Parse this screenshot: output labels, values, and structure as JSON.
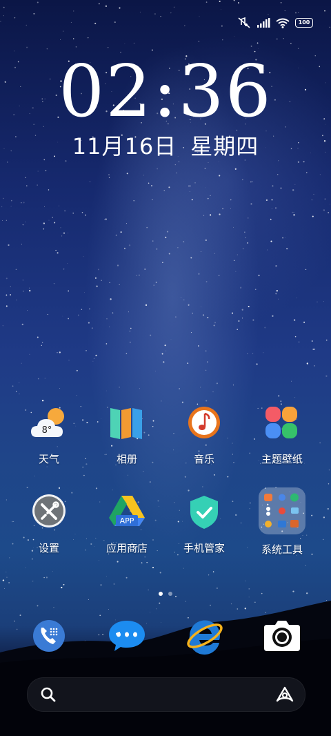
{
  "status_bar": {
    "battery": "100",
    "icons": [
      "mute-icon",
      "signal-icon",
      "wifi-icon",
      "battery-icon"
    ]
  },
  "clock": {
    "time": "02:36"
  },
  "date": {
    "day": "11月16日",
    "weekday": "星期四"
  },
  "apps": [
    {
      "label": "天气",
      "icon": "weather-icon",
      "temp": "8°"
    },
    {
      "label": "相册",
      "icon": "gallery-icon"
    },
    {
      "label": "音乐",
      "icon": "music-icon"
    },
    {
      "label": "主题壁纸",
      "icon": "themes-icon"
    },
    {
      "label": "设置",
      "icon": "settings-icon"
    },
    {
      "label": "应用商店",
      "icon": "app-store-icon",
      "badge": "APP"
    },
    {
      "label": "手机管家",
      "icon": "security-icon"
    },
    {
      "label": "系统工具",
      "icon": "folder-icon"
    }
  ],
  "page_indicator": {
    "pages": 2,
    "current": 1
  },
  "dock": [
    {
      "icon": "phone-icon"
    },
    {
      "icon": "messages-icon"
    },
    {
      "icon": "browser-icon"
    },
    {
      "icon": "camera-icon"
    }
  ],
  "search": {
    "icons": [
      "search-icon",
      "assistant-icon"
    ]
  },
  "colors": {
    "weather_sun": "#f7a93c",
    "gallery_teal": "#4ed3b5",
    "gallery_orange": "#f29a32",
    "gallery_blue": "#3aa0e8",
    "music_orange": "#e8741c",
    "themes_red": "#f45b66",
    "themes_orange": "#f8a23a",
    "themes_blue": "#4b8ff5",
    "themes_green": "#36c26a",
    "settings_gray": "#6e7378",
    "security_teal": "#35d0b5",
    "phone_blue": "#3a7bd5",
    "messages_blue": "#1c8cf0",
    "search_bar": "#14161e"
  }
}
